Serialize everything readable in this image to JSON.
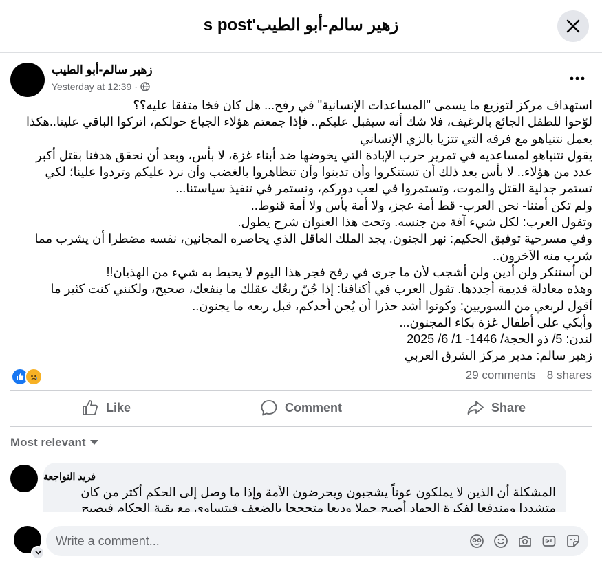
{
  "header": {
    "title": "زهير سالم-أبو الطيب's post"
  },
  "post": {
    "author": "زهير سالم-أبو الطيب",
    "time": "Yesterday at 12:39",
    "separator": "·",
    "lines": [
      "استهداف مركز لتوزيع ما يسمى \"المساعدات الإنسانية\" في رفح... هل كان فخا متفقا عليه؟؟",
      "لوّحوا للطفل الجائع بالرغيف، فلا شك أنه سيقبل عليكم.. فإذا جمعتم هؤلاء الجياع حولكم، اتركوا الباقي علينا..هكذا",
      "يعمل نتنياهو مع فرقه التي تتزيا بالزي الإنساني",
      "يقول نتنياهو لمساعديه في تمرير حرب الإبادة التي يخوضها ضد أبناء غزة، لا بأس، وبعد أن نحقق هدفنا بقتل أكبر",
      "عدد من هؤلاء.. لا بأس بعد ذلك أن تستنكروا وأن تدينوا وأن تتظاهروا بالغضب وأن نرد عليكم وتردوا علينا؛ لكي",
      "تستمر جدلية القتل والموت، وتستمروا في لعب دوركم، ونستمر في تنفيذ سياستنا...",
      "ولم تكن أمتنا- نحن العرب- قط أمة عجز، ولا أمة يأس ولا أمة قنوط..",
      "وتقول العرب: لكل شيء آفة من جنسه. وتحت هذا العنوان شرح يطول.",
      "وفي مسرحية توفيق الحكيم: نهر الجنون. يجد الملك العاقل الذي يحاصره المجانين، نفسه مضطرا أن يشرب مما",
      "شرب منه الآخرون..",
      "لن أستنكر ولن أدين ولن أشجب لأن ما جرى في رفح فجر هذا اليوم لا يحيط به شيء من الهذيان!!",
      "وهذه معادلة قديمة أجددها. تقول العرب في أكنافنا: إذا جُنّ ربعُك عقلك ما ينفعك، صحيح، ولكنني كنت كثير ما",
      "أقول لربعي من السوريين: وكونوا أشد حذرا أن يُجن أحدكم، قبل ربعه ما يجنون..",
      "وأبكي على أطفال غزة بكاء المجنون...",
      "لندن: 5/ ذو الحجة/ 1446- 1/ 6/ 2025",
      "زهير سالم: مدير مركز الشرق العربي"
    ],
    "comments_count": "29 comments",
    "shares_count": "8 shares"
  },
  "actions": {
    "like": "Like",
    "comment": "Comment",
    "share": "Share"
  },
  "sort": {
    "label": "Most relevant"
  },
  "comment": {
    "author": "فريد النواجعة",
    "lines": [
      "المشكلة أن الذين لا يملكون عوناً يشجبون ويحرضون الأمة وإذا ما وصل إلى الحكم أكثر من كان",
      "متشددا ومندفعا لفكرة الجهاد أصبح حملا وديعا متحججا بالضعف فيتساوى مع بقية الحكام فيصبح"
    ]
  },
  "composer": {
    "placeholder": "Write a comment..."
  },
  "colors": {
    "like_blue": "#1877f2",
    "haha_yellow": "#f7b125",
    "muted_text": "#65676b",
    "bubble_bg": "#f0f2f5"
  }
}
